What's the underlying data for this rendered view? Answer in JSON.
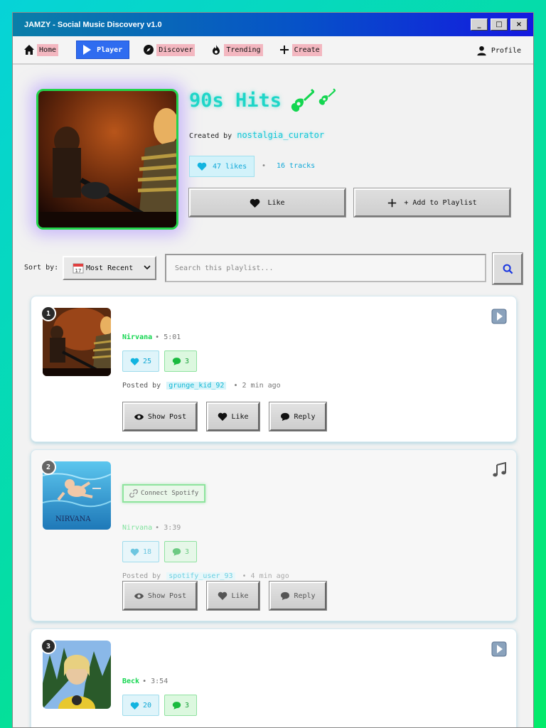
{
  "window": {
    "title": "JAMZY - Social Music Discovery v1.0",
    "buttons": {
      "minimize": "_",
      "maximize": "□",
      "close": "×"
    }
  },
  "nav": {
    "items": [
      {
        "label": "Home",
        "icon": "home-icon"
      },
      {
        "label": "Player",
        "icon": "play-icon",
        "active": true
      },
      {
        "label": "Discover",
        "icon": "compass-icon"
      },
      {
        "label": "Trending",
        "icon": "fire-icon"
      },
      {
        "label": "Create",
        "icon": "plus-icon"
      }
    ],
    "profile": "Profile"
  },
  "playlist": {
    "title": "90s Hits",
    "created_by_label": "Created by",
    "creator": "nostalgia_curator",
    "likes": "47 likes",
    "separator": "•",
    "tracks": "16 tracks",
    "like_button": "Like",
    "add_button": "+ Add to Playlist"
  },
  "controls": {
    "sort_label": "Sort by:",
    "sort_value": "Most Recent",
    "search_placeholder": "Search this playlist..."
  },
  "colors": {
    "accent_cyan": "#14c8d8",
    "accent_green": "#14d650",
    "nav_active": "#2f6cf0"
  },
  "tracks": [
    {
      "number": "1",
      "artist": "Nirvana",
      "duration": "• 5:01",
      "likes": "25",
      "comments": "3",
      "posted_label": "Posted by",
      "user": "grunge_kid_92",
      "time": "• 2 min ago",
      "show_post": "Show Post",
      "like": "Like",
      "reply": "Reply",
      "corner_icon": "play-button-icon"
    },
    {
      "number": "2",
      "connect": "Connect Spotify",
      "artist": "Nirvana",
      "duration": "• 3:39",
      "likes": "18",
      "comments": "3",
      "posted_label": "Posted by",
      "user": "spotify_user_93",
      "time": "• 4 min ago",
      "show_post": "Show Post",
      "like": "Like",
      "reply": "Reply",
      "corner_icon": "music-note-icon"
    },
    {
      "number": "3",
      "artist": "Beck",
      "duration": "• 3:54",
      "likes": "20",
      "comments": "3",
      "corner_icon": "play-button-icon"
    }
  ]
}
